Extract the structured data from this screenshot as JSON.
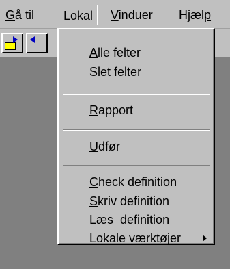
{
  "menubar": {
    "items": [
      {
        "label": "Gå til",
        "mnemonic": "G"
      },
      {
        "label": "Lokal",
        "mnemonic": "L"
      },
      {
        "label": "Vinduer",
        "mnemonic": "V"
      },
      {
        "label": "Hjælp",
        "mnemonic": "p"
      }
    ]
  },
  "toolbar": {
    "buttons": [
      {
        "icon": "open-folder-arrow-icon"
      },
      {
        "icon": "back-arrow-icon"
      }
    ]
  },
  "dropdown": {
    "items": [
      {
        "label": "Alle felter",
        "mnemonic": "A"
      },
      {
        "label": "Slet felter",
        "mnemonic": "f"
      },
      {
        "label": "Rapport",
        "mnemonic": "R"
      },
      {
        "label": "Udfør",
        "mnemonic": "U"
      },
      {
        "label": "Check definition",
        "mnemonic": "C"
      },
      {
        "label": "Skriv definition",
        "mnemonic": "S"
      },
      {
        "label": "Læs  definition",
        "mnemonic": "L"
      },
      {
        "label": "Lokale værktøjer",
        "has_submenu": true
      }
    ]
  },
  "colors": {
    "face": "#c0c0c0",
    "workspace": "#808080",
    "accent": "#0000c0"
  }
}
